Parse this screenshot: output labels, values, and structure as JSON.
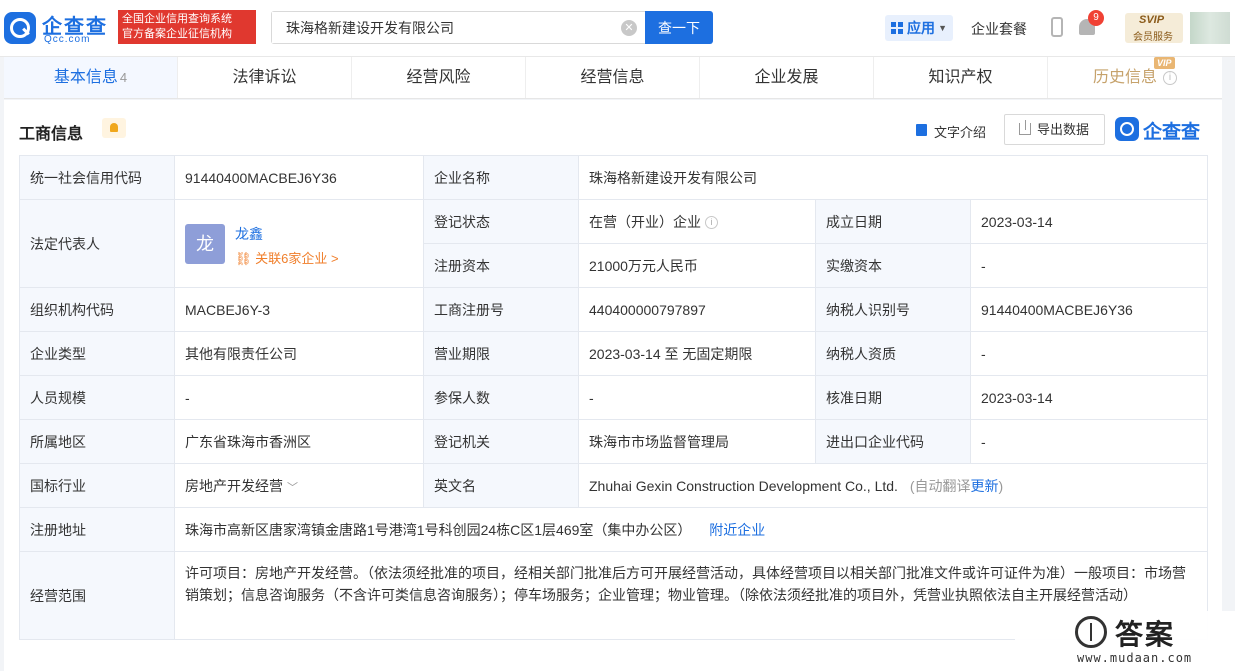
{
  "header": {
    "logo_cn": "企查查",
    "logo_en": "Qcc.com",
    "slogan_line1": "全国企业信用查询系统",
    "slogan_line2": "官方备案企业征信机构",
    "search_value": "珠海格新建设开发有限公司",
    "search_button": "查一下",
    "app_label": "应用",
    "package_label": "企业套餐",
    "notification_count": "9",
    "vip_label": "SVIP",
    "vip_sub": "会员服务"
  },
  "tabs": [
    {
      "label": "基本信息",
      "count": "4"
    },
    {
      "label": "法律诉讼"
    },
    {
      "label": "经营风险"
    },
    {
      "label": "经营信息"
    },
    {
      "label": "企业发展"
    },
    {
      "label": "知识产权"
    },
    {
      "label": "历史信息",
      "tag": "VIP"
    }
  ],
  "section": {
    "title": "工商信息",
    "text_intro": "文字介绍",
    "export": "导出数据",
    "brand": "企查查"
  },
  "info": {
    "credit_code_label": "统一社会信用代码",
    "credit_code": "91440400MACBEJ6Y36",
    "company_name_label": "企业名称",
    "company_name": "珠海格新建设开发有限公司",
    "legal_rep_label": "法定代表人",
    "legal_rep_avatar": "龙",
    "legal_rep_name": "龙鑫",
    "legal_rep_related": "关联6家企业 >",
    "reg_status_label": "登记状态",
    "reg_status": "在营（开业）企业",
    "established_label": "成立日期",
    "established": "2023-03-14",
    "reg_capital_label": "注册资本",
    "reg_capital": "21000万元人民币",
    "paid_capital_label": "实缴资本",
    "paid_capital": "-",
    "org_code_label": "组织机构代码",
    "org_code": "MACBEJ6Y-3",
    "biz_reg_no_label": "工商注册号",
    "biz_reg_no": "440400000797897",
    "taxpayer_id_label": "纳税人识别号",
    "taxpayer_id": "91440400MACBEJ6Y36",
    "company_type_label": "企业类型",
    "company_type": "其他有限责任公司",
    "biz_term_label": "营业期限",
    "biz_term": "2023-03-14 至 无固定期限",
    "taxpayer_qual_label": "纳税人资质",
    "taxpayer_qual": "-",
    "staff_size_label": "人员规模",
    "staff_size": "-",
    "insured_label": "参保人数",
    "insured": "-",
    "approval_date_label": "核准日期",
    "approval_date": "2023-03-14",
    "region_label": "所属地区",
    "region": "广东省珠海市香洲区",
    "reg_authority_label": "登记机关",
    "reg_authority": "珠海市市场监督管理局",
    "import_export_label": "进出口企业代码",
    "import_export": "-",
    "industry_label": "国标行业",
    "industry": "房地产开发经营",
    "english_name_label": "英文名",
    "english_name": "Zhuhai Gexin Construction Development Co., Ltd.",
    "auto_translate": "(自动翻译",
    "update_link": "更新",
    "close_paren": ")",
    "address_label": "注册地址",
    "address": "珠海市高新区唐家湾镇金唐路1号港湾1号科创园24栋C区1层469室（集中办公区）",
    "nearby_link": "附近企业",
    "scope_label": "经营范围",
    "scope": "许可项目：房地产开发经营。（依法须经批准的项目，经相关部门批准后方可开展经营活动，具体经营项目以相关部门批准文件或许可证件为准）一般项目：市场营销策划；信息咨询服务（不含许可类信息咨询服务）；停车场服务；企业管理；物业管理。（除依法须经批准的项目外，凭营业执照依法自主开展经营活动）"
  },
  "watermark": {
    "text": "答案",
    "url": "www.mudaan.com"
  },
  "colors": {
    "brand_blue": "#1d6fe0",
    "slogan_red": "#e0382f",
    "label_bg": "#f5f8fd",
    "related_orange": "#f07e2a"
  }
}
